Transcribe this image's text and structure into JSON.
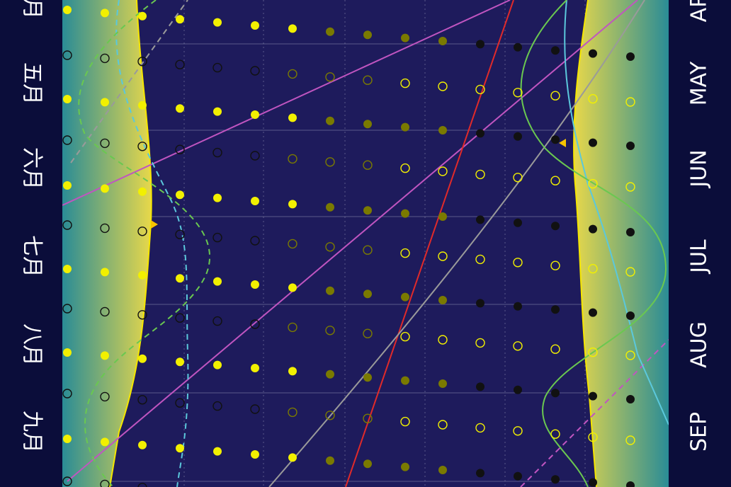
{
  "chart_data": {
    "type": "scatter",
    "title": "",
    "xlabel": "",
    "ylabel": "",
    "orientation": "vertical-time",
    "colors": {
      "background": "#0b0d3a",
      "plot_bg": "#1e1b5c",
      "twilight_left_start": "#2a8c96",
      "twilight_right_start": "#e8d84a",
      "grid": "#8a8ab0",
      "moon_full": "#f2f000",
      "moon_dim": "#7a7a00",
      "moon_new": "#111111",
      "line_magenta": "#c055c0",
      "line_red": "#e02a2a",
      "line_gray": "#9a9a9a",
      "line_cyan": "#5bc8dc",
      "line_green": "#6ac850",
      "marker": "#f5c400",
      "label": "#ffffff"
    },
    "left_month_labels": [
      "五月",
      "六月",
      "七月",
      "八月",
      "九月"
    ],
    "left_top_partial": "月",
    "right_month_labels": [
      "MAY",
      "JUN",
      "JUL",
      "AUG",
      "SEP"
    ],
    "right_top_partial": "AP",
    "months_axis": [
      "Apr",
      "May",
      "Jun",
      "Jul",
      "Aug",
      "Sep"
    ],
    "grid": true,
    "series": [
      {
        "kind": "curve",
        "color": "line_magenta",
        "style": "solid"
      },
      {
        "kind": "curve",
        "color": "line_red",
        "style": "solid"
      },
      {
        "kind": "curve",
        "color": "line_gray",
        "style": "solid"
      },
      {
        "kind": "curve",
        "color": "line_gray",
        "style": "dashed"
      },
      {
        "kind": "curve",
        "color": "line_magenta",
        "style": "dashed"
      },
      {
        "kind": "curve",
        "color": "line_cyan",
        "style": "dashed"
      },
      {
        "kind": "curve",
        "color": "line_green",
        "style": "dashed"
      },
      {
        "kind": "curve",
        "color": "line_cyan",
        "style": "solid"
      },
      {
        "kind": "curve",
        "color": "line_green",
        "style": "solid"
      }
    ]
  }
}
